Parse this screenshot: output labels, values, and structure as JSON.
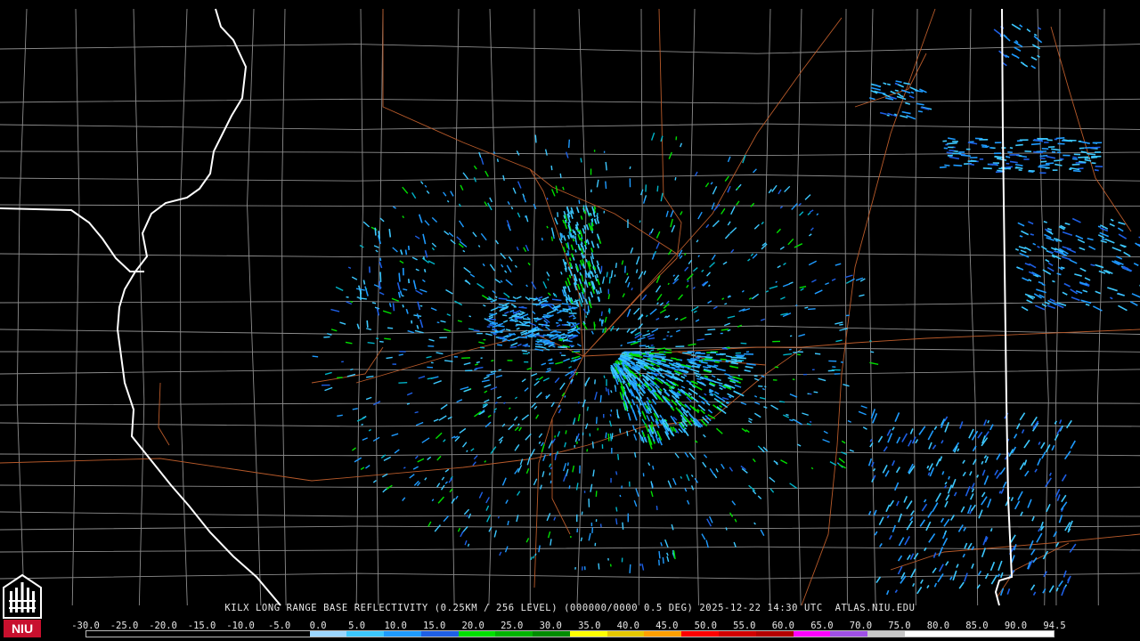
{
  "product_caption": "KILX LONG RANGE BASE REFLECTIVITY (0.25KM / 256 LEVEL) (000000/0000 0.5 DEG) 2025-12-22 14:30 UTC  ATLAS.NIU.EDU",
  "logo_text": "NIU",
  "scale": {
    "labels": [
      "-30.0",
      "-25.0",
      "-20.0",
      "-15.0",
      "-10.0",
      "-5.0",
      "0.0",
      "5.0",
      "10.0",
      "15.0",
      "20.0",
      "25.0",
      "30.0",
      "35.0",
      "40.0",
      "45.0",
      "50.0",
      "55.0",
      "60.0",
      "65.0",
      "70.0",
      "75.0",
      "80.0",
      "85.0",
      "90.0",
      "94.5"
    ],
    "colors": [
      "#000000",
      "#000000",
      "#000000",
      "#000000",
      "#000000",
      "#000000",
      "#9bd6ff",
      "#3cc8ff",
      "#1e9bff",
      "#1e5fe6",
      "#00e000",
      "#00b400",
      "#008c00",
      "#ffff00",
      "#e6c800",
      "#ffa000",
      "#ff0000",
      "#d20000",
      "#b40000",
      "#ff00ff",
      "#a050e6",
      "#c8c8c8",
      "#ffffff",
      "#ffffff",
      "#ffffff",
      "#ffffff"
    ]
  },
  "colors": {
    "state_border": "#ffffff",
    "county_border": "#8c8c8c",
    "highway": "#b85a2a",
    "caption_text": "#e8e8e8",
    "logo_red": "#c8102e"
  }
}
